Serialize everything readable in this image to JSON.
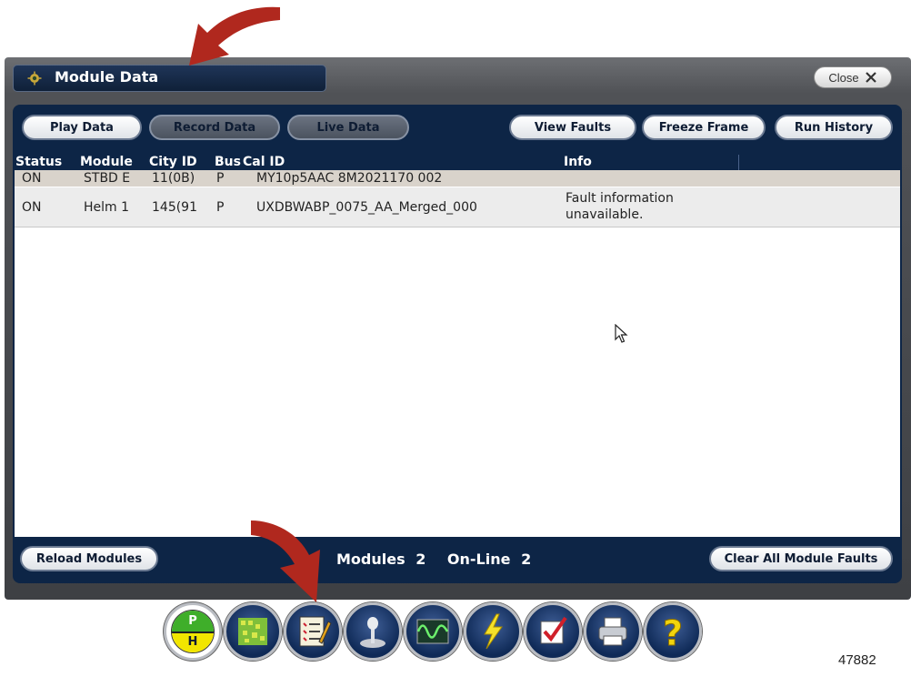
{
  "window": {
    "title": "Module Data",
    "close_label": "Close"
  },
  "top_buttons": {
    "play": "Play Data",
    "record": "Record Data",
    "live": "Live Data",
    "view_faults": "View Faults",
    "freeze_frame": "Freeze Frame",
    "run_history": "Run History"
  },
  "table": {
    "columns": [
      "Status",
      "Module",
      "City ID",
      "Bus",
      "Cal ID",
      "Info"
    ],
    "rows": [
      {
        "status": "ON",
        "module": "STBD E",
        "city_id": "11(0B)",
        "bus": "P",
        "cal_id": "MY10p5AAC 8M2021170 002",
        "info": ""
      },
      {
        "status": "ON",
        "module": "Helm 1",
        "city_id": "145(91",
        "bus": "P",
        "cal_id": "UXDBWABP_0075_AA_Merged_000",
        "info_line1": "Fault information",
        "info_line2": "unavailable."
      }
    ]
  },
  "bottom": {
    "reload": "Reload Modules",
    "modules_label": "Modules",
    "modules_count": "2",
    "online_label": "On-Line",
    "online_count": "2",
    "clear_faults": "Clear All Module Faults"
  },
  "toolbar": {
    "ph_top": "P",
    "ph_bottom": "H",
    "icons": [
      "ph-gauge-icon",
      "circuit-board-icon",
      "checklist-icon",
      "joystick-icon",
      "waveform-icon",
      "lightning-icon",
      "checkbox-icon",
      "printer-icon",
      "help-icon"
    ]
  },
  "figure_number": "47882",
  "colors": {
    "panel": "#0d2546",
    "arrow": "#b0281e",
    "selected_row": "#d9d3cb"
  }
}
